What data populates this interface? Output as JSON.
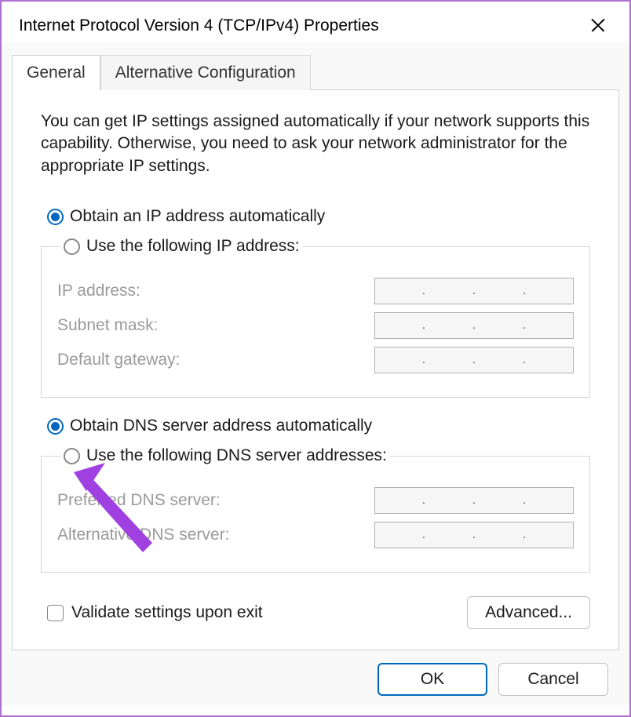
{
  "titlebar": {
    "title": "Internet Protocol Version 4 (TCP/IPv4) Properties"
  },
  "tabs": {
    "general": "General",
    "alternative": "Alternative Configuration"
  },
  "intro": "You can get IP settings assigned automatically if your network supports this capability. Otherwise, you need to ask your network administrator for the appropriate IP settings.",
  "ip_section": {
    "auto_label": "Obtain an IP address automatically",
    "manual_label": "Use the following IP address:",
    "fields": {
      "ip_address": "IP address:",
      "subnet_mask": "Subnet mask:",
      "default_gateway": "Default gateway:"
    }
  },
  "dns_section": {
    "auto_label": "Obtain DNS server address automatically",
    "manual_label": "Use the following DNS server addresses:",
    "fields": {
      "preferred": "Preferred DNS server:",
      "alternative": "Alternative DNS server:"
    }
  },
  "validate_label": "Validate settings upon exit",
  "advanced_label": "Advanced...",
  "ok_label": "OK",
  "cancel_label": "Cancel"
}
